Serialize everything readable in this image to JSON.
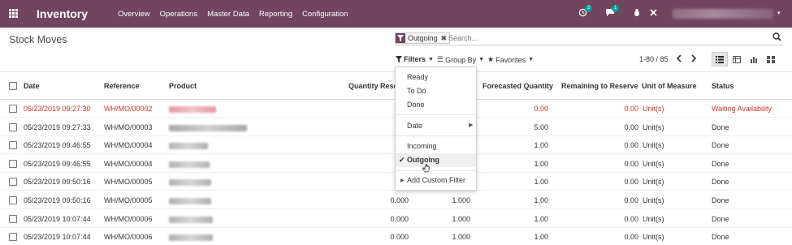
{
  "app": {
    "title": "Inventory",
    "menu": [
      "Overview",
      "Operations",
      "Master Data",
      "Reporting",
      "Configuration"
    ],
    "notif_activity_count": "2",
    "notif_messages_count": "1",
    "user_caret": "▾"
  },
  "page": {
    "title": "Stock Moves"
  },
  "search": {
    "facet": "Outgoing",
    "facet_remove": "✖",
    "placeholder": "Search..."
  },
  "toolbar": {
    "filters": "Filters",
    "group_by": "Group By",
    "favorites": "Favorites",
    "pager": "1-80 / 85"
  },
  "filters_menu": {
    "items": [
      "Ready",
      "To Do",
      "Done",
      "Date",
      "Incoming",
      "Outgoing",
      "Add Custom Filter"
    ],
    "selected": "Outgoing"
  },
  "table": {
    "headers": [
      "Date",
      "Reference",
      "Product",
      "Quantity Reserved",
      "Forecasted Quantity",
      "Remaining to Reserve",
      "Unit of Measure",
      "Status"
    ],
    "rows": [
      {
        "date": "05/23/2019 09:27:30",
        "ref": "WH/MO/00002",
        "reserved": "",
        "done": "",
        "forecast": "0.00",
        "remaining": "0.00",
        "uom": "Unit(s)",
        "status": "Waiting Availability",
        "red": true
      },
      {
        "date": "05/23/2019 09:27:33",
        "ref": "WH/MO/00003",
        "reserved": "0.",
        "done": "",
        "forecast": "5.00",
        "remaining": "0.00",
        "uom": "Unit(s)",
        "status": "Done",
        "red": false
      },
      {
        "date": "05/23/2019 09:46:55",
        "ref": "WH/MO/00004",
        "reserved": "0.",
        "done": "",
        "forecast": "1.00",
        "remaining": "0.00",
        "uom": "Unit(s)",
        "status": "Done",
        "red": false
      },
      {
        "date": "05/23/2019 09:46:55",
        "ref": "WH/MO/00004",
        "reserved": "0.",
        "done": "",
        "forecast": "1.00",
        "remaining": "0.00",
        "uom": "Unit(s)",
        "status": "Done",
        "red": false
      },
      {
        "date": "05/23/2019 09:50:16",
        "ref": "WH/MO/00005",
        "reserved": "0.",
        "done": "",
        "forecast": "1.00",
        "remaining": "0.00",
        "uom": "Unit(s)",
        "status": "Done",
        "red": false
      },
      {
        "date": "05/23/2019 09:50:16",
        "ref": "WH/MO/00005",
        "reserved": "0.000",
        "done": "1.000",
        "forecast": "1.00",
        "remaining": "0.00",
        "uom": "Unit(s)",
        "status": "Done",
        "red": false
      },
      {
        "date": "05/23/2019 10:07:44",
        "ref": "WH/MO/00006",
        "reserved": "0.000",
        "done": "1.000",
        "forecast": "1.00",
        "remaining": "0.00",
        "uom": "Unit(s)",
        "status": "Done",
        "red": false
      },
      {
        "date": "05/23/2019 10:07:44",
        "ref": "WH/MO/00006",
        "reserved": "0.000",
        "done": "1.000",
        "forecast": "1.00",
        "remaining": "0.00",
        "uom": "Unit(s)",
        "status": "Done",
        "red": false
      }
    ]
  },
  "colors": {
    "brand": "#71445f",
    "warning_red": "#c0392b",
    "badge_teal": "#00a09d"
  }
}
